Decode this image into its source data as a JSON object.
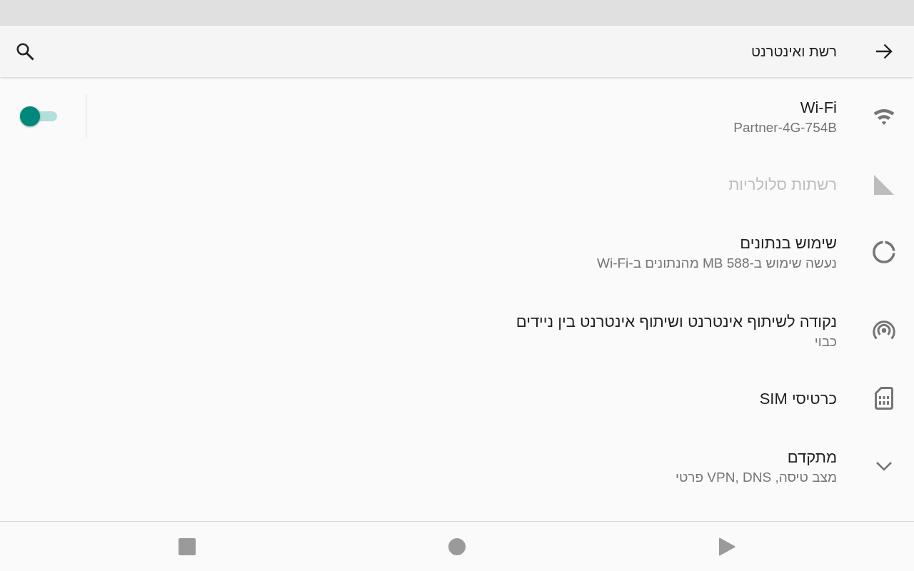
{
  "toolbar": {
    "title": "רשת ואינטרנט"
  },
  "items": [
    {
      "kind": "wifi",
      "title": "Wi-Fi",
      "subtitle": "Partner-4G-754B",
      "disabled": false,
      "toggle": {
        "on": true
      }
    },
    {
      "kind": "cellular",
      "title": "רשתות סלולריות",
      "disabled": true
    },
    {
      "kind": "data-usage",
      "title": "שימוש בנתונים",
      "subtitle": "נעשה שימוש ב-588 MB מהנתונים ב-Wi-Fi",
      "disabled": false
    },
    {
      "kind": "hotspot",
      "title": "נקודה לשיתוף אינטרנט ושיתוף אינטרנט בין ניידים",
      "subtitle": "כבוי",
      "disabled": false
    },
    {
      "kind": "sim",
      "title": "כרטיסי SIM",
      "disabled": false
    },
    {
      "kind": "advanced",
      "title": "מתקדם",
      "subtitle": "מצב טיסה, VPN, DNS פרטי",
      "disabled": false,
      "expanded": false
    }
  ]
}
